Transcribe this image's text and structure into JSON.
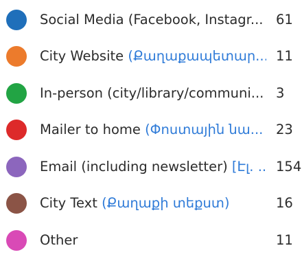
{
  "legend": {
    "items": [
      {
        "label": "Social Media (Facebook, Instagr...",
        "label_extra": "",
        "count": "61",
        "color": "#1f6fba"
      },
      {
        "label": "City Website ",
        "label_extra": "(Քաղաքապետար...",
        "count": "11",
        "color": "#ec7b2c"
      },
      {
        "label": "In-person (city/library/communi...",
        "label_extra": "",
        "count": "3",
        "color": "#22a444"
      },
      {
        "label": "Mailer to home ",
        "label_extra": "(Փոստային նա...",
        "count": "23",
        "color": "#dd2a2a"
      },
      {
        "label": "Email (including newsletter) ",
        "label_extra": "[Էլ. ...",
        "count": "154",
        "color": "#8c66bd"
      },
      {
        "label": "City Text ",
        "label_extra": "(Քաղաքի տեքստ)",
        "count": "16",
        "color": "#8b5446"
      },
      {
        "label": "Other",
        "label_extra": "",
        "count": "11",
        "color": "#d94ab6"
      }
    ]
  }
}
